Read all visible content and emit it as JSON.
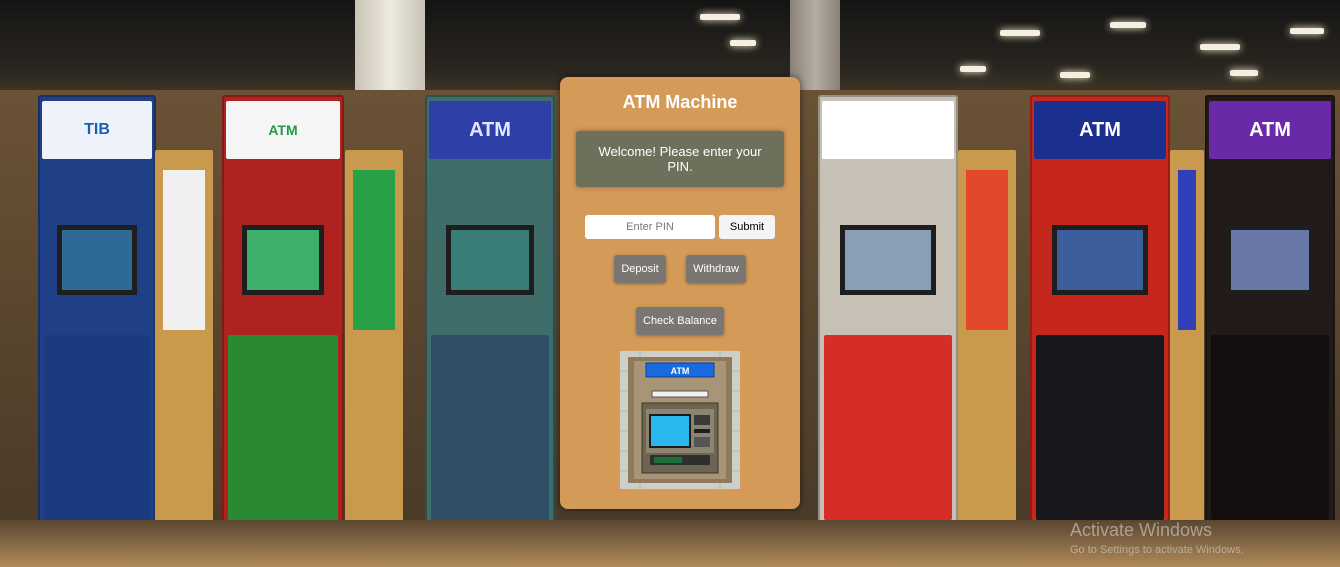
{
  "atm": {
    "title": "ATM Machine",
    "message": "Welcome! Please enter your PIN.",
    "pin_placeholder": "Enter PIN",
    "pin_value": "",
    "submit_label": "Submit",
    "deposit_label": "Deposit",
    "withdraw_label": "Withdraw",
    "balance_label": "Check Balance",
    "image_sign": "ATM"
  },
  "background": {
    "kiosk_signs": [
      "TIB",
      "ATM",
      "ATM",
      "ATM",
      "ATM"
    ]
  },
  "watermark": {
    "title": "Activate Windows",
    "subtitle": "Go to Settings to activate Windows."
  },
  "colors": {
    "card": "#d39a58",
    "message_box": "#6d715b",
    "button_gray": "#7a7772"
  }
}
